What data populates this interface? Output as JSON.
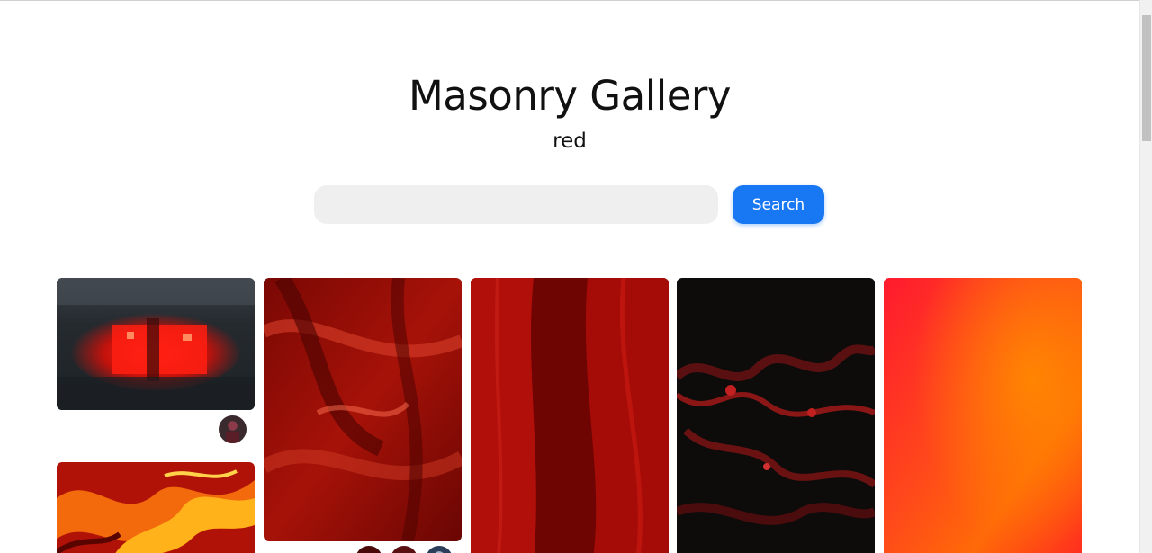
{
  "header": {
    "title": "Masonry Gallery",
    "subtitle": "red"
  },
  "search": {
    "value": "",
    "placeholder": "",
    "button_label": "Search"
  },
  "colors": {
    "accent": "#1877f2",
    "input_background": "#efefef"
  },
  "gallery": {
    "images": [
      {
        "name": "red-reflection-puddle"
      },
      {
        "name": "red-satin-fabric"
      },
      {
        "name": "red-leaf-closeup"
      },
      {
        "name": "red-black-fractal"
      },
      {
        "name": "red-orange-gradient"
      },
      {
        "name": "red-orange-marble-swirl"
      }
    ],
    "avatars": [
      {
        "name": "photographer-avatar"
      },
      {
        "name": "photographer-avatar"
      },
      {
        "name": "photographer-avatar"
      },
      {
        "name": "photographer-avatar"
      }
    ]
  }
}
